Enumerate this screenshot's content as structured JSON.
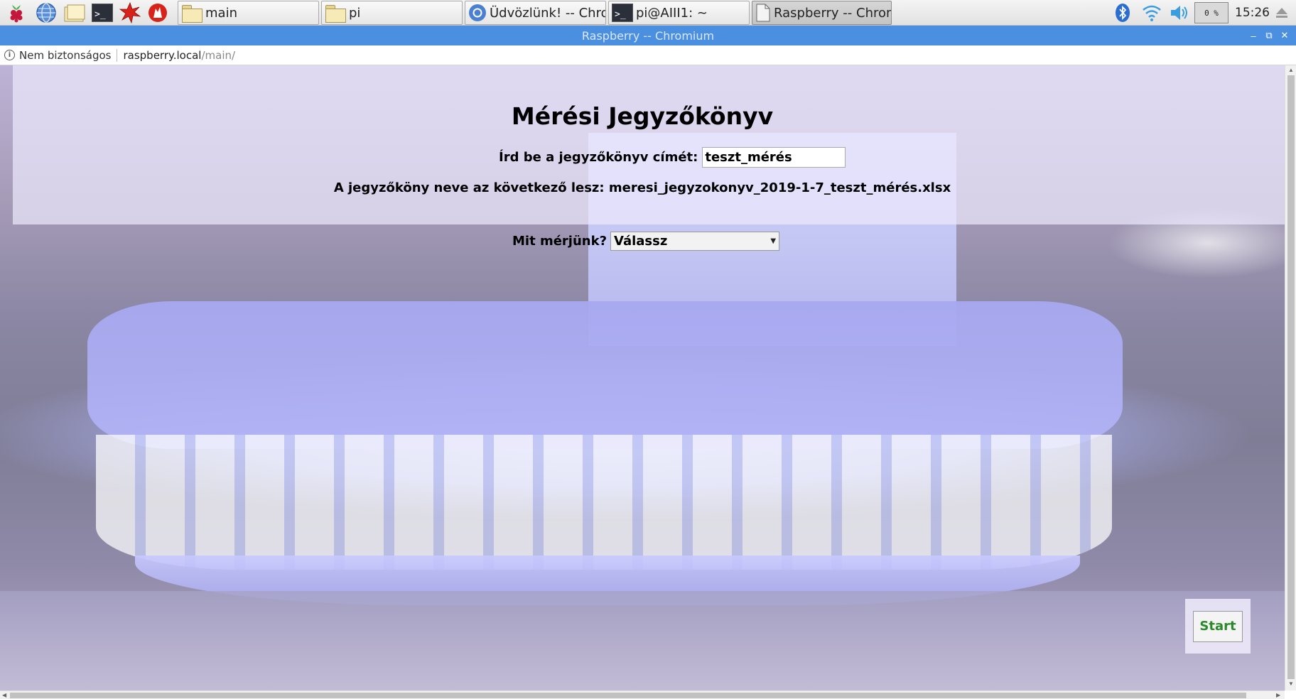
{
  "taskbar": {
    "tasks": [
      {
        "label": "main",
        "icon": "folder-icon"
      },
      {
        "label": "pi",
        "icon": "folder-icon"
      },
      {
        "label": "Üdvözlünk! -- Chromi...",
        "icon": "chromium-icon"
      },
      {
        "label": "pi@AIII1: ~",
        "icon": "terminal-icon"
      },
      {
        "label": "Raspberry -- Chromiu...",
        "icon": "document-icon"
      }
    ],
    "cpu": "0 %",
    "clock": "15:26"
  },
  "browser": {
    "window_title": "Raspberry -- Chromium",
    "security_label": "Nem biztonságos",
    "url_host": "raspberry.local",
    "url_path": "/main/"
  },
  "page": {
    "title": "Mérési Jegyzőkönyv",
    "title_prompt": "Írd be a jegyzőkönyv címét:",
    "title_value": "teszt_mérés",
    "filename_text": "A jegyzőköny neve az következő lesz: meresi_jegyzokonyv_2019-1-7_teszt_mérés.xlsx",
    "measure_label": "Mit mérjünk?",
    "measure_selected": "Válassz",
    "start_label": "Start"
  },
  "colors": {
    "titlebar": "#4a8fe0",
    "start_text": "#2a8a2a"
  }
}
